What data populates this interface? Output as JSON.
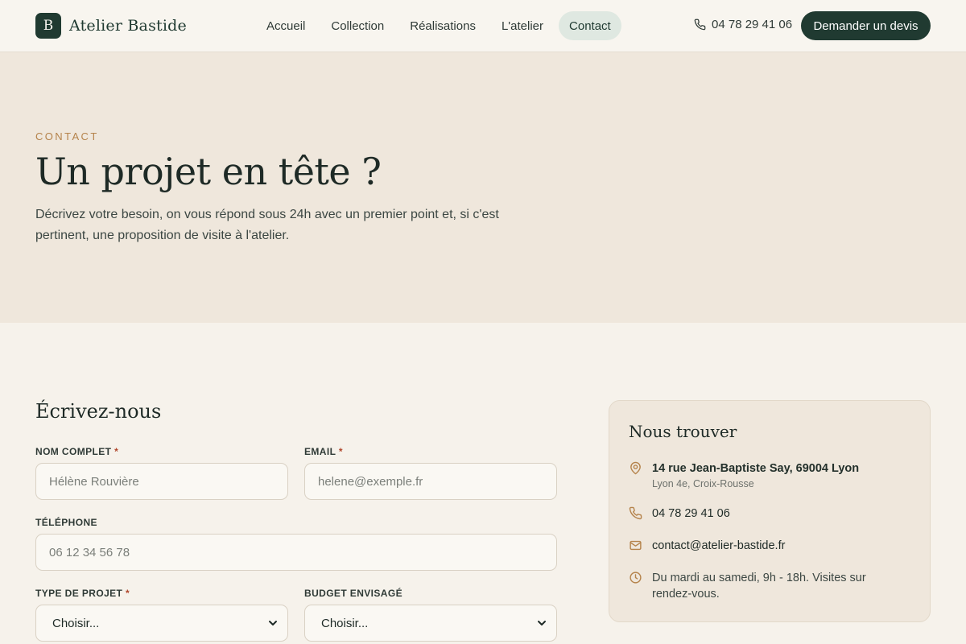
{
  "header": {
    "brand_mark": "B",
    "brand_name": "Atelier Bastide",
    "nav": [
      "Accueil",
      "Collection",
      "Réalisations",
      "L'atelier",
      "Contact"
    ],
    "active_nav": "Contact",
    "phone": "04 78 29 41 06",
    "cta_label": "Demander un devis"
  },
  "hero": {
    "eyebrow": "CONTACT",
    "title": "Un projet en tête ?",
    "description": "Décrivez votre besoin, on vous répond sous 24h avec un premier point et, si c'est pertinent, une proposition de visite à l'atelier."
  },
  "form": {
    "title": "Écrivez-nous",
    "name": {
      "label": "NOM COMPLET",
      "required_mark": "*",
      "placeholder": "Hélène Rouvière",
      "value": ""
    },
    "email": {
      "label": "EMAIL",
      "required_mark": "*",
      "placeholder": "helene@exemple.fr",
      "value": ""
    },
    "phone": {
      "label": "TÉLÉPHONE",
      "placeholder": "06 12 34 56 78",
      "value": ""
    },
    "project_type": {
      "label": "TYPE DE PROJET",
      "required_mark": "*",
      "selected": "Choisir..."
    },
    "budget": {
      "label": "BUDGET ENVISAGÉ",
      "selected": "Choisir..."
    }
  },
  "contact_card": {
    "title": "Nous trouver",
    "address": "14 rue Jean-Baptiste Say, 69004 Lyon",
    "address_sub": "Lyon 4e, Croix-Rousse",
    "phone": "04 78 29 41 06",
    "email": "contact@atelier-bastide.fr",
    "hours": "Du mardi au samedi, 9h - 18h. Visites sur rendez-vous."
  },
  "colors": {
    "brand_dark": "#203a31",
    "accent_gold": "#b5834b",
    "hero_bg": "#efe7dc",
    "page_bg": "#f6f2eb",
    "active_nav_bg": "#dfe8e1",
    "required": "#b0472c"
  },
  "icons": {
    "header_phone": "phone-icon",
    "address": "map-pin-icon",
    "phone": "phone-icon",
    "email": "mail-icon",
    "hours": "clock-icon",
    "select": "chevron-down-icon"
  }
}
